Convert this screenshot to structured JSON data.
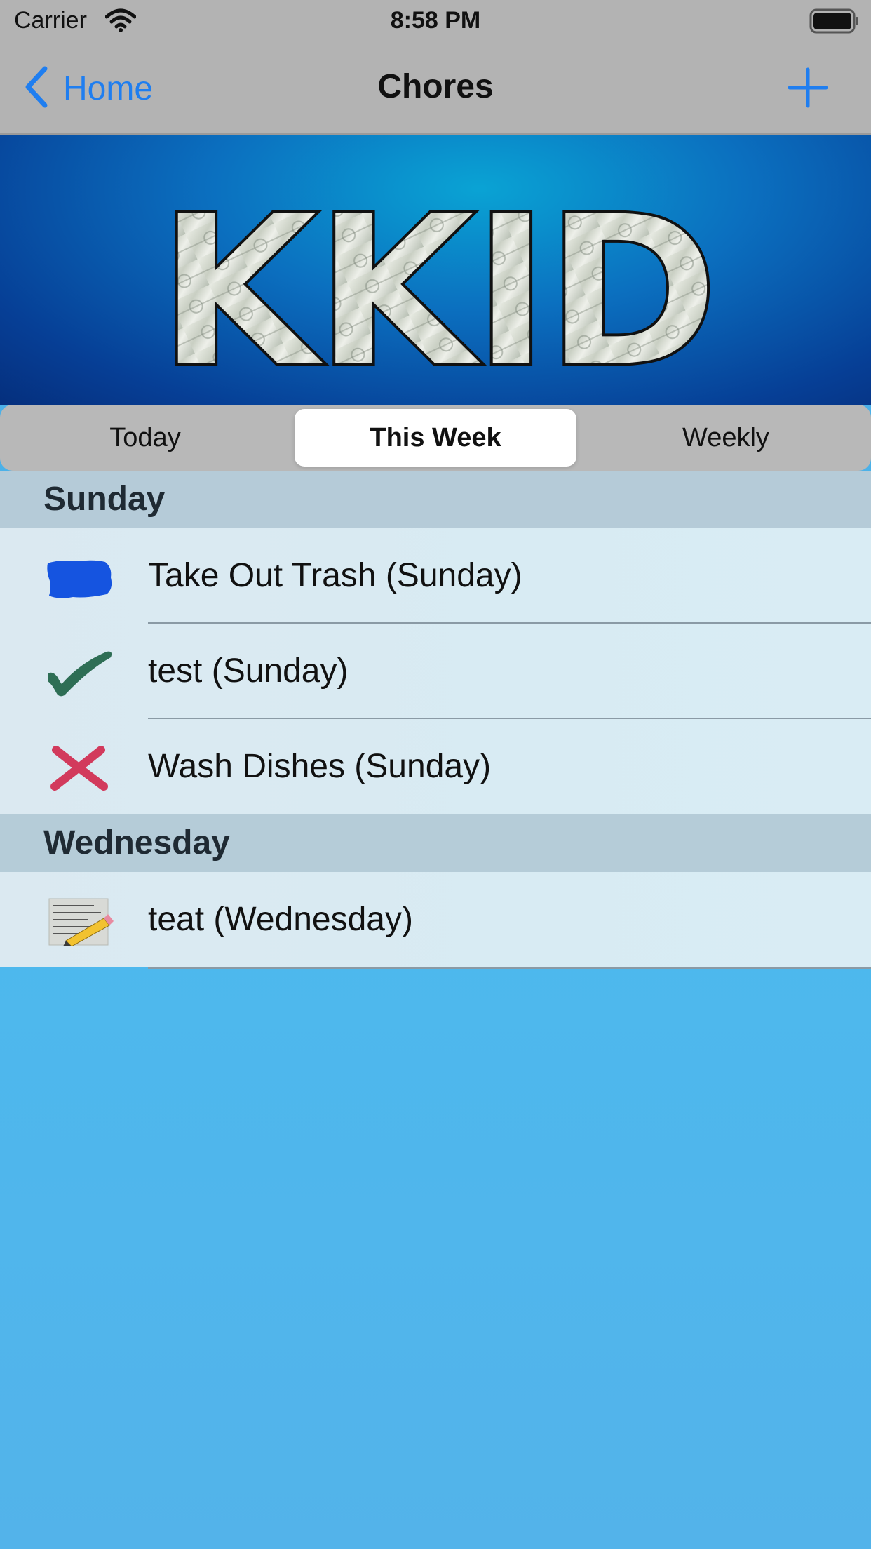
{
  "status_bar": {
    "carrier": "Carrier",
    "time": "8:58 PM",
    "wifi_icon": "wifi-icon",
    "battery_icon": "battery-icon"
  },
  "nav": {
    "back_label": "Home",
    "back_icon": "chevron-left-icon",
    "title": "Chores",
    "add_icon": "plus-icon"
  },
  "banner": {
    "logo_text": "KKID"
  },
  "segments": {
    "items": [
      "Today",
      "This Week",
      "Weekly"
    ],
    "selected": "This Week"
  },
  "sections": [
    {
      "header": "Sunday",
      "rows": [
        {
          "label": "Take Out Trash (Sunday)",
          "icon": "blue-paint-swatch-icon"
        },
        {
          "label": "test (Sunday)",
          "icon": "green-checkmark-icon"
        },
        {
          "label": "Wash Dishes (Sunday)",
          "icon": "red-x-icon"
        }
      ]
    },
    {
      "header": "Wednesday",
      "rows": [
        {
          "label": "teat (Wednesday)",
          "icon": "note-pencil-icon"
        }
      ]
    }
  ],
  "colors": {
    "accent": "#1f7ef0",
    "nav_bar": "#b3b3b3",
    "background": "#4cb9ee",
    "check_green": "#2e6e55",
    "x_red": "#d23a5c",
    "paint_blue": "#1554e0"
  }
}
